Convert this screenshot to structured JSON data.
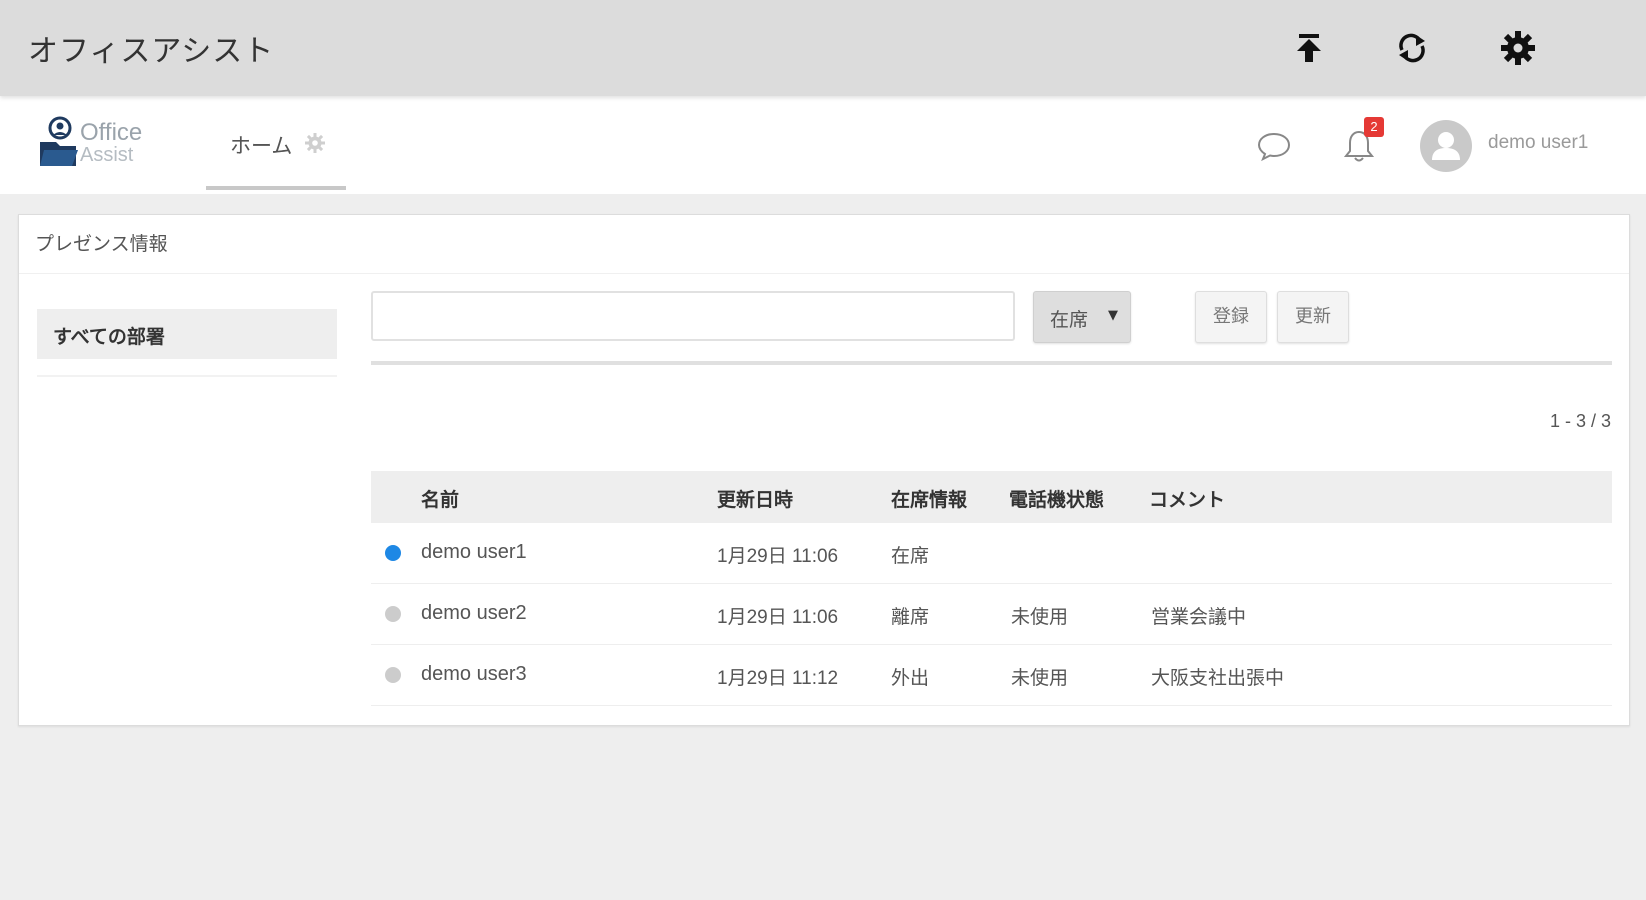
{
  "app": {
    "title": "オフィスアシスト"
  },
  "topbar_icons": {
    "upload": "upload-icon",
    "sync": "sync-icon",
    "settings": "settings-icon"
  },
  "header": {
    "logo_text": "Office",
    "logo_sub": "Assist",
    "home_tab": "ホーム",
    "notification_count": "2",
    "username": "demo user1"
  },
  "card": {
    "title": "プレゼンス情報",
    "department": "すべての部署",
    "search": {
      "value": "",
      "placeholder": ""
    },
    "presence_select": "在席",
    "register_button": "登録",
    "refresh_button": "更新",
    "pager": "1 - 3 / 3"
  },
  "table": {
    "columns": [
      "名前",
      "更新日時",
      "在席情報",
      "電話機状態",
      "コメント"
    ],
    "rows": [
      {
        "status_color": "#1e88e5",
        "name": "demo user1",
        "updated": "1月29日 11:06",
        "presence": "在席",
        "phone": "",
        "comment": ""
      },
      {
        "status_color": "#cccccc",
        "name": "demo user2",
        "updated": "1月29日 11:06",
        "presence": "離席",
        "phone": "未使用",
        "comment": "営業会議中"
      },
      {
        "status_color": "#cccccc",
        "name": "demo user3",
        "updated": "1月29日 11:12",
        "presence": "外出",
        "phone": "未使用",
        "comment": "大阪支社出張中"
      }
    ]
  }
}
